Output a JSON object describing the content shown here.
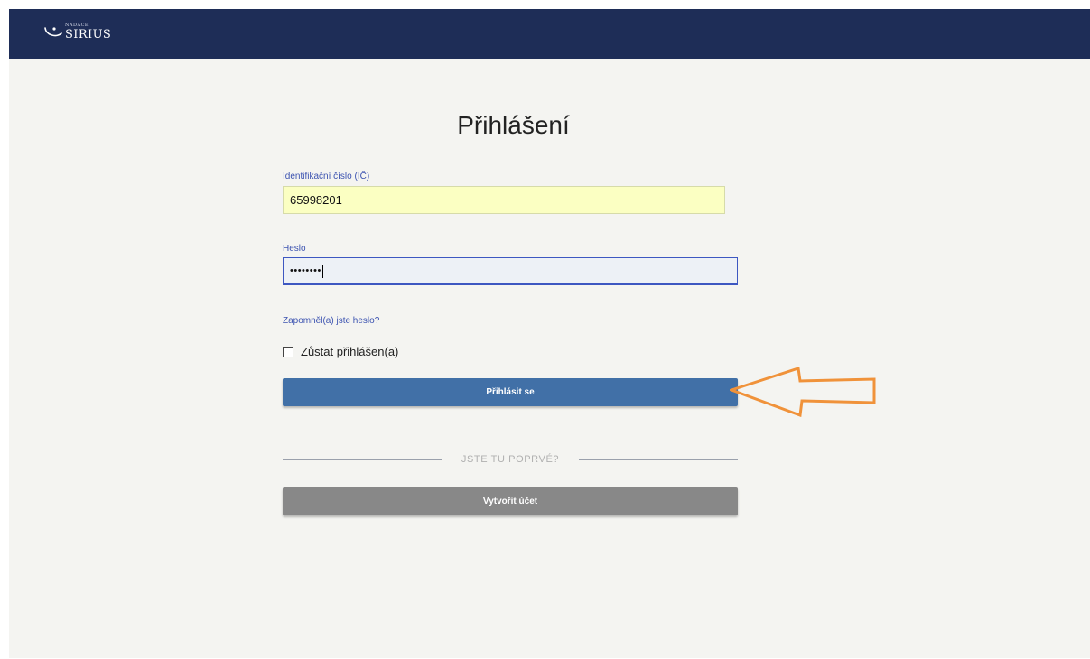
{
  "brand": {
    "small": "NADACE",
    "name": "SIRIUS"
  },
  "page": {
    "title": "Přihlášení"
  },
  "form": {
    "ic_label": "Identifikační číslo (IČ)",
    "ic_value": "65998201",
    "password_label": "Heslo",
    "password_masked": "••••••••",
    "forgot_link": "Zapomněl(a) jste heslo?",
    "remember_label": "Zůstat přihlášen(a)",
    "remember_checked": false,
    "login_button": "Přihlásit se"
  },
  "signup": {
    "divider_text": "JSTE TU POPRVÉ?",
    "create_button": "Vytvořit účet"
  },
  "colors": {
    "topbar": "#1e2d57",
    "background": "#f4f4f1",
    "primary_button": "#4170a7",
    "secondary_button": "#888888",
    "label_text": "#3b52b0",
    "autofill_field": "#fbffc2",
    "annotation_arrow": "#f0923a"
  },
  "annotation": {
    "arrow_icon": "arrow-left-outline-icon"
  }
}
